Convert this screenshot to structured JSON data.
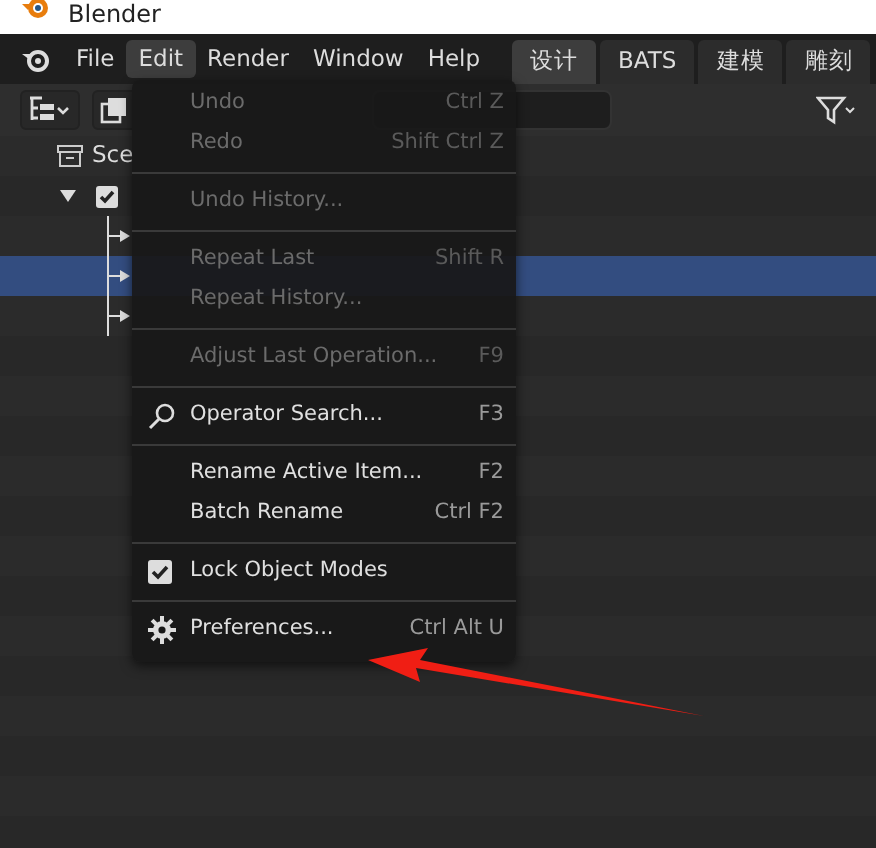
{
  "window": {
    "title": "Blender"
  },
  "menu_bar": [
    {
      "label": "File",
      "selected": false
    },
    {
      "label": "Edit",
      "selected": true
    },
    {
      "label": "Render",
      "selected": false
    },
    {
      "label": "Window",
      "selected": false
    },
    {
      "label": "Help",
      "selected": false
    }
  ],
  "workspace_tabs": [
    {
      "label": "设计",
      "selected": true
    },
    {
      "label": "BATS",
      "selected": false
    },
    {
      "label": "建模",
      "selected": false
    },
    {
      "label": "雕刻",
      "selected": false
    }
  ],
  "outliner": {
    "rows": [
      {
        "kind": "scene",
        "label": "Sce",
        "selected": false
      },
      {
        "kind": "collection",
        "checked": true,
        "expanded": true,
        "selected": false
      },
      {
        "kind": "child",
        "selected": false
      },
      {
        "kind": "child",
        "selected": true
      },
      {
        "kind": "child",
        "selected": false
      }
    ]
  },
  "edit_menu": [
    {
      "kind": "command",
      "label": "Undo",
      "shortcut": "Ctrl Z",
      "disabled": true
    },
    {
      "kind": "command",
      "label": "Redo",
      "shortcut": "Shift Ctrl Z",
      "disabled": true
    },
    {
      "kind": "separator"
    },
    {
      "kind": "command",
      "label": "Undo History...",
      "disabled": true
    },
    {
      "kind": "separator"
    },
    {
      "kind": "command",
      "label": "Repeat Last",
      "shortcut": "Shift R",
      "disabled": true
    },
    {
      "kind": "command",
      "label": "Repeat History...",
      "disabled": true
    },
    {
      "kind": "separator"
    },
    {
      "kind": "command",
      "label": "Adjust Last Operation...",
      "shortcut": "F9",
      "disabled": true
    },
    {
      "kind": "separator"
    },
    {
      "kind": "search",
      "label": "Operator Search...",
      "shortcut": "F3",
      "disabled": false
    },
    {
      "kind": "separator"
    },
    {
      "kind": "command",
      "label": "Rename Active Item...",
      "shortcut": "F2",
      "disabled": false
    },
    {
      "kind": "command",
      "label": "Batch Rename",
      "shortcut": "Ctrl F2",
      "disabled": false
    },
    {
      "kind": "separator"
    },
    {
      "kind": "toggle",
      "label": "Lock Object Modes",
      "checked": true,
      "disabled": false
    },
    {
      "kind": "separator"
    },
    {
      "kind": "settings",
      "label": "Preferences...",
      "shortcut": "Ctrl Alt U",
      "disabled": false
    }
  ]
}
